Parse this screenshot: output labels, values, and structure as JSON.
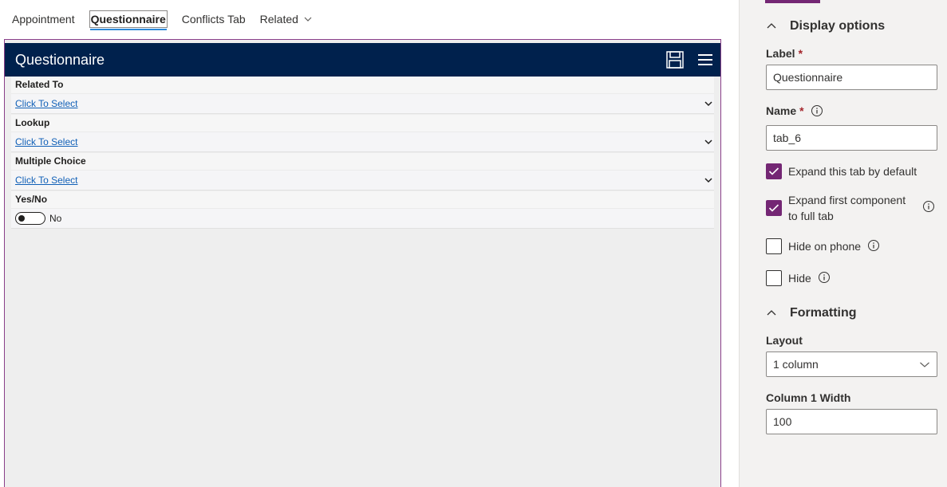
{
  "tabs": [
    {
      "label": "Appointment"
    },
    {
      "label": "Questionnaire"
    },
    {
      "label": "Conflicts Tab"
    },
    {
      "label": "Related"
    }
  ],
  "form": {
    "title": "Questionnaire",
    "fields": [
      {
        "label": "Related To",
        "value": "Click To Select"
      },
      {
        "label": "Lookup",
        "value": "Click To Select"
      },
      {
        "label": "Multiple Choice",
        "value": "Click To Select"
      }
    ],
    "yesno": {
      "label": "Yes/No",
      "value": "No"
    }
  },
  "props": {
    "display_options": "Display options",
    "label_label": "Label",
    "label_value": "Questionnaire",
    "name_label": "Name",
    "name_value": "tab_6",
    "required_mark": "*",
    "checks": [
      {
        "label": "Expand this tab by default",
        "checked": true
      },
      {
        "label": "Expand first component to full tab",
        "checked": true
      },
      {
        "label": "Hide on phone",
        "checked": false
      },
      {
        "label": "Hide",
        "checked": false
      }
    ],
    "formatting": "Formatting",
    "layout_label": "Layout",
    "layout_value": "1 column",
    "col_width_label": "Column 1 Width",
    "col_width_value": "100"
  },
  "colors": {
    "header_bg": "#00214d",
    "accent": "#742774",
    "link": "#1160b7"
  }
}
